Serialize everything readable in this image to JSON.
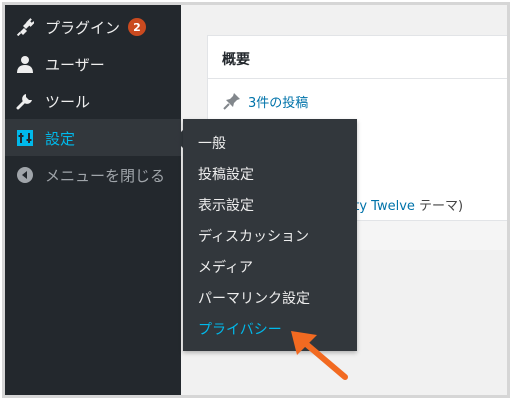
{
  "sidebar": {
    "items": [
      {
        "label": "プラグイン",
        "icon": "plugin-icon",
        "badge": "2"
      },
      {
        "label": "ユーザー",
        "icon": "user-icon"
      },
      {
        "label": "ツール",
        "icon": "wrench-icon"
      },
      {
        "label": "設定",
        "icon": "settings-icon"
      },
      {
        "label": "メニューを閉じる",
        "icon": "collapse-icon"
      }
    ]
  },
  "main": {
    "panel_title": "概要",
    "posts_link": "3件の投稿",
    "theme_link": "nty Twelve",
    "theme_suffix": " テーマ)"
  },
  "submenu": {
    "items": [
      {
        "label": "一般"
      },
      {
        "label": "投稿設定"
      },
      {
        "label": "表示設定"
      },
      {
        "label": "ディスカッション"
      },
      {
        "label": "メディア"
      },
      {
        "label": "パーマリンク設定"
      },
      {
        "label": "プライバシー"
      }
    ]
  },
  "colors": {
    "sidebar_bg": "#23282d",
    "flyout_bg": "#32373c",
    "accent": "#00b9eb",
    "badge": "#ca4a1f",
    "link": "#0073aa",
    "arrow": "#f26a21"
  }
}
